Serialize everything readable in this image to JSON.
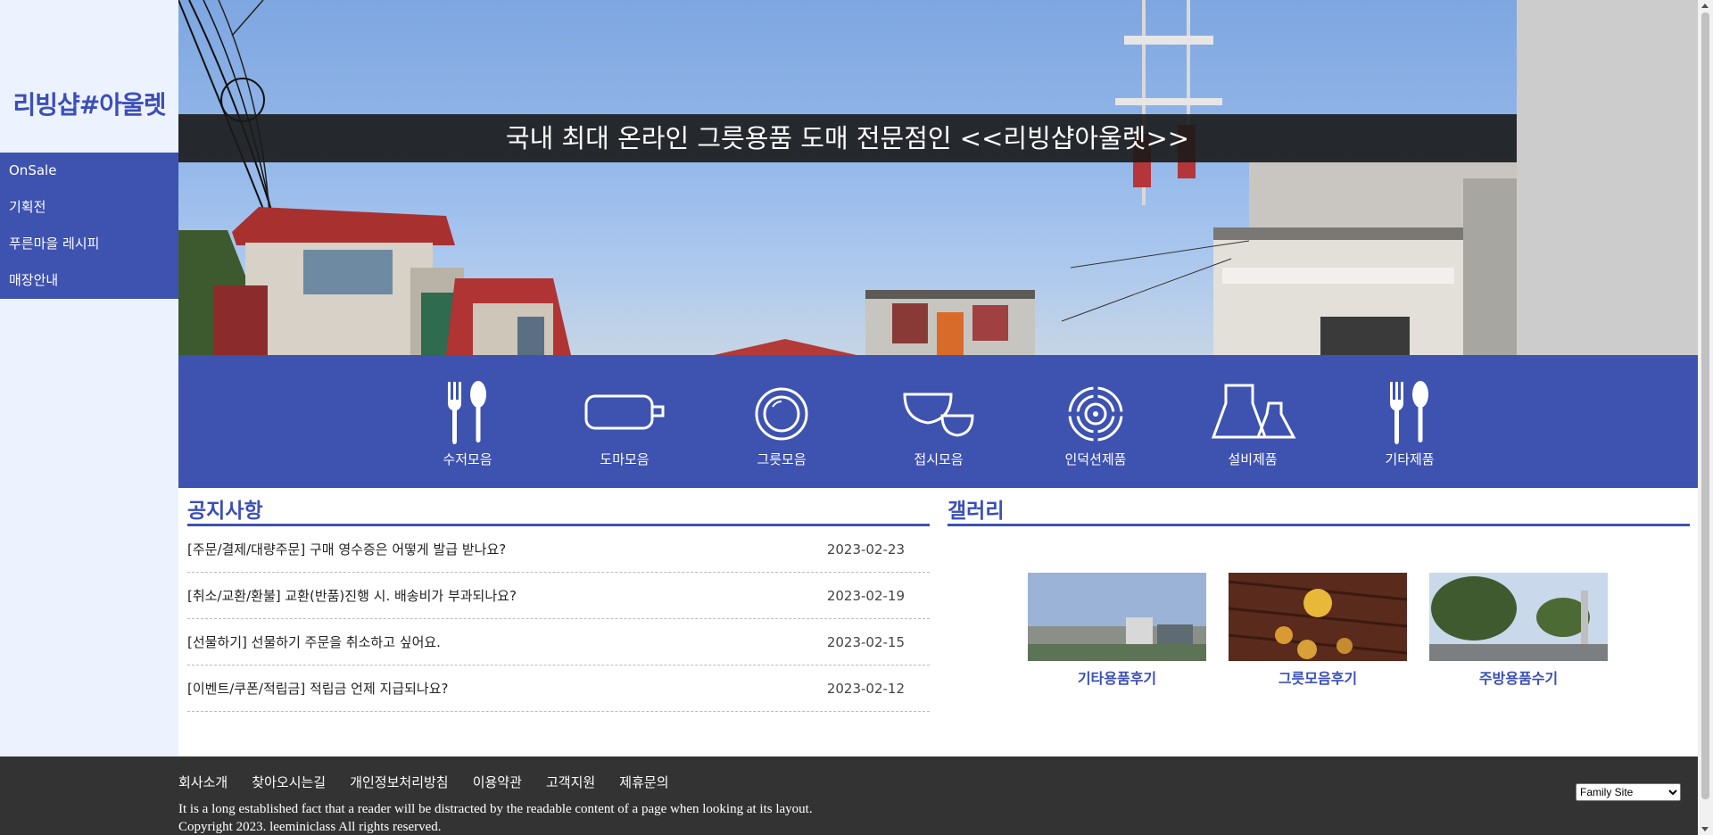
{
  "brand": {
    "logo": "리빙샵#아울렛",
    "accent": "#3e52b0"
  },
  "nav": {
    "items": [
      "OnSale",
      "기획전",
      "푸른마을 레시피",
      "매장안내"
    ]
  },
  "hero": {
    "title": "국내 최대 온라인 그릇용품 도매 전문점인 <<리빙샵아울렛>>"
  },
  "categories": [
    {
      "label": "수저모음",
      "icon": "spoon-fork-icon"
    },
    {
      "label": "도마모음",
      "icon": "cutting-board-icon"
    },
    {
      "label": "그릇모음",
      "icon": "plate-icon"
    },
    {
      "label": "접시모음",
      "icon": "bowls-icon"
    },
    {
      "label": "인덕션제품",
      "icon": "induction-icon"
    },
    {
      "label": "설비제품",
      "icon": "equipment-icon"
    },
    {
      "label": "기타제품",
      "icon": "spoon-fork-icon"
    }
  ],
  "notice": {
    "title": "공지사항",
    "items": [
      {
        "title": "[주문/결제/대량주문] 구매 영수증은 어떻게 발급 받나요?",
        "date": "2023-02-23"
      },
      {
        "title": "[취소/교환/환불] 교환(반품)진행 시. 배송비가 부과되나요?",
        "date": "2023-02-19"
      },
      {
        "title": "[선물하기] 선물하기 주문을 취소하고 싶어요.",
        "date": "2023-02-15"
      },
      {
        "title": "[이벤트/쿠폰/적립금] 적립금 언제 지급되나요?",
        "date": "2023-02-12"
      }
    ]
  },
  "gallery": {
    "title": "갤러리",
    "items": [
      {
        "label": "기타용품후기"
      },
      {
        "label": "그릇모음후기"
      },
      {
        "label": "주방용품수기"
      }
    ]
  },
  "footer": {
    "links": [
      "회사소개",
      "찾아오시는길",
      "개인정보처리방침",
      "이용약관",
      "고객지원",
      "제휴문의"
    ],
    "description": "It is a long established fact that a reader will be distracted by the readable content of a page when looking at its layout.",
    "copyright": "Copyright 2023. leeminiclass All rights reserved.",
    "family_site": {
      "selected": "Family Site"
    }
  }
}
